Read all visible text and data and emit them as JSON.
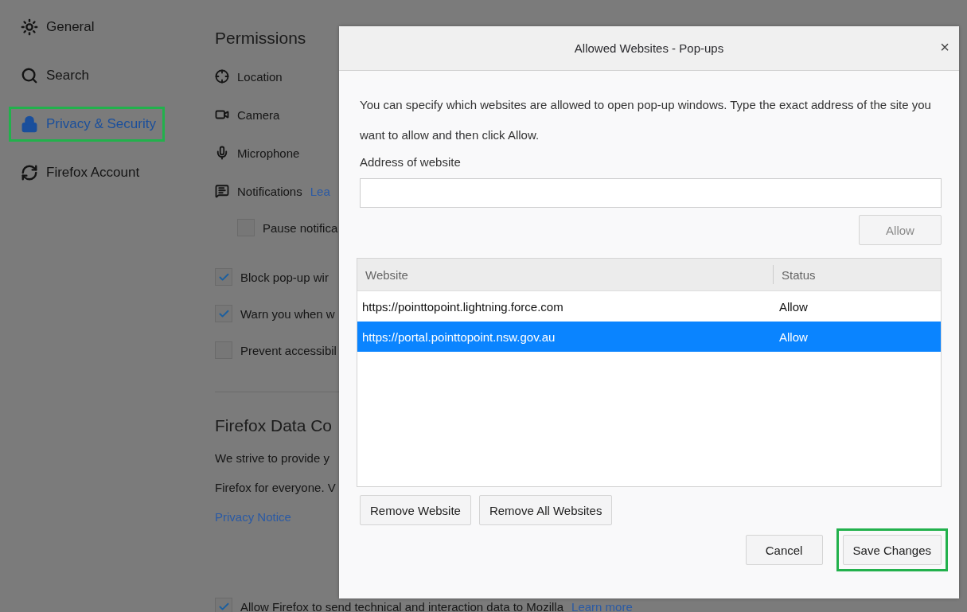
{
  "sidebar": {
    "items": [
      {
        "label": "General",
        "selected": false,
        "highlighted": false
      },
      {
        "label": "Search",
        "selected": false,
        "highlighted": false
      },
      {
        "label": "Privacy & Security",
        "selected": true,
        "highlighted": true
      },
      {
        "label": "Firefox Account",
        "selected": false,
        "highlighted": false
      }
    ]
  },
  "permissions": {
    "title": "Permissions",
    "items": [
      {
        "label": "Location"
      },
      {
        "label": "Camera"
      },
      {
        "label": "Microphone"
      },
      {
        "label": "Notifications",
        "link": "Lea"
      }
    ],
    "checkboxes": [
      {
        "label": "Pause notifica",
        "checked": false,
        "indented": true
      },
      {
        "label": "Block pop-up wir",
        "checked": true,
        "indented": false
      },
      {
        "label": "Warn you when w",
        "checked": true,
        "indented": false
      },
      {
        "label": "Prevent accessibil",
        "checked": false,
        "indented": false
      }
    ]
  },
  "data_collection": {
    "title": "Firefox Data Co",
    "lines": [
      "We strive to provide y",
      "Firefox for everyone. V"
    ],
    "link": "Privacy Notice",
    "checkbox": {
      "label": "Allow Firefox to send technical and interaction data to Mozilla",
      "checked": true,
      "link": "Learn more"
    }
  },
  "dialog": {
    "title": "Allowed Websites - Pop-ups",
    "close": "×",
    "description": "You can specify which websites are allowed to open pop-up windows. Type the exact address of the site you want to allow and then click Allow.",
    "address_label": "Address of website",
    "allow_button": {
      "label": "Allow",
      "disabled": true
    },
    "table": {
      "columns": [
        "Website",
        "Status"
      ],
      "rows": [
        {
          "website": "https://pointtopoint.lightning.force.com",
          "status": "Allow",
          "selected": false
        },
        {
          "website": "https://portal.pointtopoint.nsw.gov.au",
          "status": "Allow",
          "selected": true
        }
      ]
    },
    "remove_buttons": [
      "Remove Website",
      "Remove All Websites"
    ],
    "footer_buttons": [
      {
        "label": "Cancel",
        "highlighted": false
      },
      {
        "label": "Save Changes",
        "highlighted": true
      }
    ]
  }
}
